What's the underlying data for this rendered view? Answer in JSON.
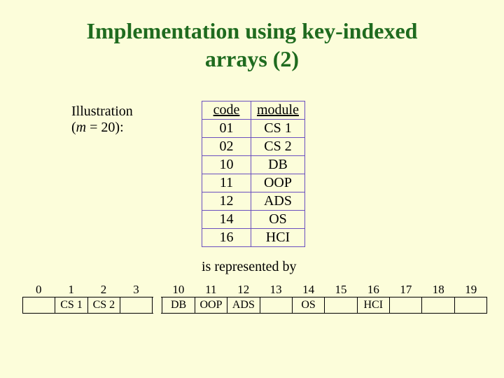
{
  "title_line1": "Implementation using key-indexed",
  "title_line2": "arrays (2)",
  "illustration": {
    "label": "Illustration",
    "prefix": "(",
    "m": "m",
    "eq": " = 20):",
    "suffix": ""
  },
  "table": {
    "headers": {
      "code": "code",
      "module": "module"
    },
    "rows": [
      {
        "code": "01",
        "module": "CS 1"
      },
      {
        "code": "02",
        "module": "CS 2"
      },
      {
        "code": "10",
        "module": "DB"
      },
      {
        "code": "11",
        "module": "OOP"
      },
      {
        "code": "12",
        "module": "ADS"
      },
      {
        "code": "14",
        "module": "OS"
      },
      {
        "code": "16",
        "module": "HCI"
      }
    ]
  },
  "represented": "is represented by",
  "array": {
    "left": {
      "indices": [
        "0",
        "1",
        "2",
        "3"
      ],
      "values": [
        "",
        "CS 1",
        "CS 2",
        ""
      ]
    },
    "right": {
      "indices": [
        "10",
        "11",
        "12",
        "13",
        "14",
        "15",
        "16",
        "17",
        "18",
        "19"
      ],
      "values": [
        "DB",
        "OOP",
        "ADS",
        "",
        "OS",
        "",
        "HCI",
        "",
        "",
        ""
      ]
    }
  }
}
